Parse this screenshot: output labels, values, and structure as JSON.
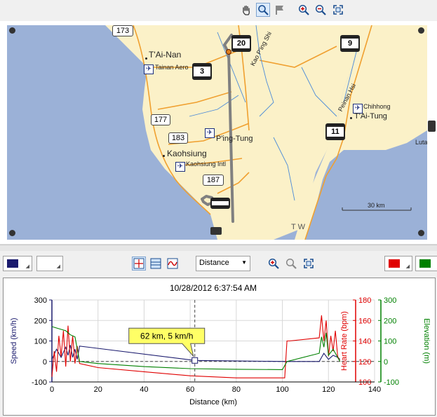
{
  "colors": {
    "map_water": "#9bb1d7",
    "map_land": "#fbf1c8",
    "route": "#808080",
    "speed": "#1b1b6e",
    "heart_rate": "#e00000",
    "elevation": "#008000",
    "callout_bg": "#ffff66"
  },
  "top_toolbar": {
    "icons": [
      "hand-pan-icon",
      "zoom-magnifier-icon",
      "flag-icon",
      "zoom-in-icon",
      "zoom-out-icon",
      "zoom-extents-icon"
    ]
  },
  "map": {
    "route_shields": [
      "173",
      "20",
      "9",
      "3",
      "177",
      "183",
      "11",
      "187"
    ],
    "places": {
      "tainan": "T'Ai-Nan",
      "tainan_aero": "Tainan Aero",
      "kao_ping_shi": "Kao P'ing Shi",
      "pingtung": "P'ing-Tung",
      "kaohsiung": "Kaohsiung",
      "kaohsiung_intl": "Kaohsiung Intl",
      "peinan_hsi": "Peinan Hsi",
      "chihhong": "Chihhong",
      "taitung": "T'Ai-Tung",
      "luta": "Luta",
      "bottom_partial": "T W"
    },
    "scale_label": "30 km"
  },
  "chart_toolbar": {
    "x_axis_mode": "Distance",
    "speed_swatch_color": "#1b1b6e",
    "hr_swatch_color": "#e00000",
    "elev_swatch_color": "#008000"
  },
  "chart_data": {
    "type": "line",
    "title": "10/28/2012 6:37:54 AM",
    "xlabel": "Distance (km)",
    "xlim": [
      0,
      140
    ],
    "x_ticks": [
      "0",
      "20",
      "40",
      "60",
      "80",
      "100",
      "120",
      "140"
    ],
    "axes": {
      "speed": {
        "label": "Speed (km/h)",
        "ylim": [
          -100,
          300
        ],
        "ticks": [
          "-100",
          "0",
          "100",
          "200",
          "300"
        ]
      },
      "heart_rate": {
        "label": "Heart Rate (bpm)",
        "ylim": [
          100,
          180
        ],
        "ticks": [
          "100",
          "120",
          "140",
          "160",
          "180"
        ]
      },
      "elevation": {
        "label": "Elevation (m)",
        "ylim": [
          -100,
          300
        ],
        "ticks": [
          "-100",
          "0",
          "100",
          "200",
          "300"
        ]
      }
    },
    "cursor": {
      "x": 62,
      "label": "62 km, 5 km/h"
    },
    "series": [
      {
        "name": "Speed (km/h)",
        "axis": "speed",
        "x": [
          0,
          2,
          4,
          6,
          7,
          8,
          9,
          10,
          11,
          12,
          62,
          102,
          103,
          116,
          118,
          120,
          122,
          124,
          125
        ],
        "y": [
          10,
          60,
          20,
          70,
          30,
          80,
          20,
          60,
          10,
          75,
          5,
          0,
          0,
          0,
          40,
          10,
          30,
          20,
          10
        ]
      },
      {
        "name": "Heart Rate (bpm)",
        "axis": "heart_rate",
        "x": [
          0,
          1,
          2,
          3,
          4,
          5,
          6,
          7,
          8,
          9,
          10,
          11,
          12,
          20,
          40,
          60,
          80,
          100,
          101,
          102,
          103,
          116,
          117,
          118,
          119,
          120,
          121,
          122,
          123,
          124,
          125
        ],
        "y": [
          105,
          130,
          110,
          145,
          125,
          150,
          115,
          155,
          120,
          145,
          118,
          135,
          118,
          114,
          110,
          106,
          104,
          104,
          104,
          140,
          140,
          143,
          165,
          140,
          160,
          125,
          145,
          130,
          150,
          125,
          120
        ]
      },
      {
        "name": "Elevation (m)",
        "axis": "elevation",
        "x": [
          0,
          3,
          6,
          8,
          10,
          12,
          20,
          40,
          60,
          80,
          100,
          102,
          116,
          117,
          118,
          119,
          120,
          122,
          124,
          125
        ],
        "y": [
          170,
          160,
          150,
          130,
          120,
          0,
          -10,
          -25,
          -35,
          -38,
          -40,
          0,
          40,
          120,
          70,
          140,
          30,
          60,
          20,
          0
        ]
      }
    ]
  }
}
